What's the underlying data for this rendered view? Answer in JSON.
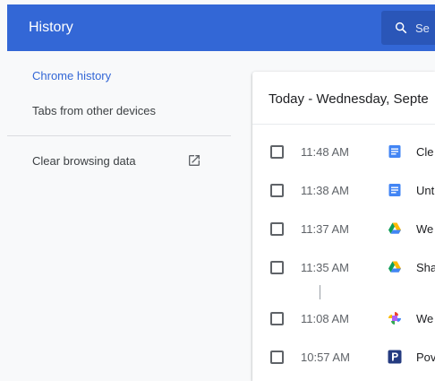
{
  "header": {
    "title": "History",
    "search_placeholder": "Se",
    "search_icon": "search-icon"
  },
  "sidebar": {
    "items": [
      {
        "label": "Chrome history",
        "active": true
      },
      {
        "label": "Tabs from other devices",
        "active": false
      },
      {
        "label": "Clear browsing data",
        "icon": "open-in-new-icon"
      }
    ]
  },
  "history": {
    "date_header": "Today - Wednesday, Septe",
    "entries": [
      {
        "time": "11:48 AM",
        "title": "Cle",
        "favicon": "google-docs-icon"
      },
      {
        "time": "11:38 AM",
        "title": "Unt",
        "favicon": "google-docs-icon"
      },
      {
        "time": "11:37 AM",
        "title": "We",
        "favicon": "google-drive-icon"
      },
      {
        "time": "11:35 AM",
        "title": "Sha",
        "favicon": "google-drive-icon"
      },
      {
        "time": "11:08 AM",
        "title": "We",
        "favicon": "google-photos-icon"
      },
      {
        "time": "10:57 AM",
        "title": "Pov",
        "favicon": "paypal-icon"
      }
    ]
  },
  "colors": {
    "header_bg": "#3367d6",
    "active_link": "#3367d6",
    "docs_blue": "#4285f4",
    "paypal_navy": "#253b80"
  }
}
